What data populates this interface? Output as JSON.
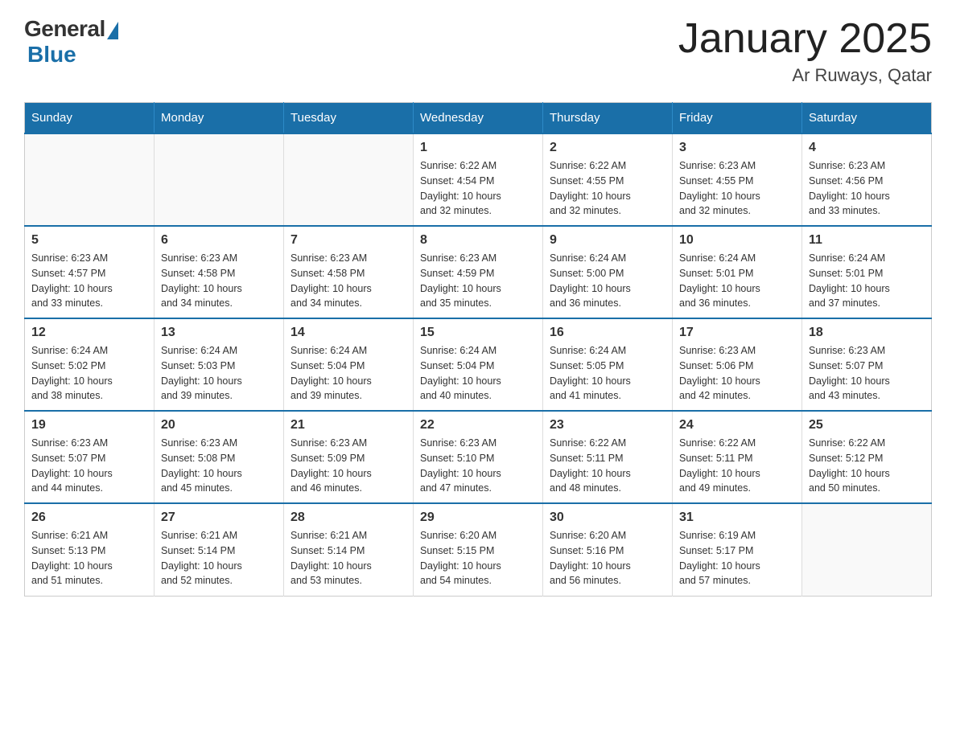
{
  "logo": {
    "general": "General",
    "blue": "Blue"
  },
  "title": "January 2025",
  "subtitle": "Ar Ruways, Qatar",
  "days_of_week": [
    "Sunday",
    "Monday",
    "Tuesday",
    "Wednesday",
    "Thursday",
    "Friday",
    "Saturday"
  ],
  "weeks": [
    [
      {
        "day": "",
        "info": ""
      },
      {
        "day": "",
        "info": ""
      },
      {
        "day": "",
        "info": ""
      },
      {
        "day": "1",
        "info": "Sunrise: 6:22 AM\nSunset: 4:54 PM\nDaylight: 10 hours\nand 32 minutes."
      },
      {
        "day": "2",
        "info": "Sunrise: 6:22 AM\nSunset: 4:55 PM\nDaylight: 10 hours\nand 32 minutes."
      },
      {
        "day": "3",
        "info": "Sunrise: 6:23 AM\nSunset: 4:55 PM\nDaylight: 10 hours\nand 32 minutes."
      },
      {
        "day": "4",
        "info": "Sunrise: 6:23 AM\nSunset: 4:56 PM\nDaylight: 10 hours\nand 33 minutes."
      }
    ],
    [
      {
        "day": "5",
        "info": "Sunrise: 6:23 AM\nSunset: 4:57 PM\nDaylight: 10 hours\nand 33 minutes."
      },
      {
        "day": "6",
        "info": "Sunrise: 6:23 AM\nSunset: 4:58 PM\nDaylight: 10 hours\nand 34 minutes."
      },
      {
        "day": "7",
        "info": "Sunrise: 6:23 AM\nSunset: 4:58 PM\nDaylight: 10 hours\nand 34 minutes."
      },
      {
        "day": "8",
        "info": "Sunrise: 6:23 AM\nSunset: 4:59 PM\nDaylight: 10 hours\nand 35 minutes."
      },
      {
        "day": "9",
        "info": "Sunrise: 6:24 AM\nSunset: 5:00 PM\nDaylight: 10 hours\nand 36 minutes."
      },
      {
        "day": "10",
        "info": "Sunrise: 6:24 AM\nSunset: 5:01 PM\nDaylight: 10 hours\nand 36 minutes."
      },
      {
        "day": "11",
        "info": "Sunrise: 6:24 AM\nSunset: 5:01 PM\nDaylight: 10 hours\nand 37 minutes."
      }
    ],
    [
      {
        "day": "12",
        "info": "Sunrise: 6:24 AM\nSunset: 5:02 PM\nDaylight: 10 hours\nand 38 minutes."
      },
      {
        "day": "13",
        "info": "Sunrise: 6:24 AM\nSunset: 5:03 PM\nDaylight: 10 hours\nand 39 minutes."
      },
      {
        "day": "14",
        "info": "Sunrise: 6:24 AM\nSunset: 5:04 PM\nDaylight: 10 hours\nand 39 minutes."
      },
      {
        "day": "15",
        "info": "Sunrise: 6:24 AM\nSunset: 5:04 PM\nDaylight: 10 hours\nand 40 minutes."
      },
      {
        "day": "16",
        "info": "Sunrise: 6:24 AM\nSunset: 5:05 PM\nDaylight: 10 hours\nand 41 minutes."
      },
      {
        "day": "17",
        "info": "Sunrise: 6:23 AM\nSunset: 5:06 PM\nDaylight: 10 hours\nand 42 minutes."
      },
      {
        "day": "18",
        "info": "Sunrise: 6:23 AM\nSunset: 5:07 PM\nDaylight: 10 hours\nand 43 minutes."
      }
    ],
    [
      {
        "day": "19",
        "info": "Sunrise: 6:23 AM\nSunset: 5:07 PM\nDaylight: 10 hours\nand 44 minutes."
      },
      {
        "day": "20",
        "info": "Sunrise: 6:23 AM\nSunset: 5:08 PM\nDaylight: 10 hours\nand 45 minutes."
      },
      {
        "day": "21",
        "info": "Sunrise: 6:23 AM\nSunset: 5:09 PM\nDaylight: 10 hours\nand 46 minutes."
      },
      {
        "day": "22",
        "info": "Sunrise: 6:23 AM\nSunset: 5:10 PM\nDaylight: 10 hours\nand 47 minutes."
      },
      {
        "day": "23",
        "info": "Sunrise: 6:22 AM\nSunset: 5:11 PM\nDaylight: 10 hours\nand 48 minutes."
      },
      {
        "day": "24",
        "info": "Sunrise: 6:22 AM\nSunset: 5:11 PM\nDaylight: 10 hours\nand 49 minutes."
      },
      {
        "day": "25",
        "info": "Sunrise: 6:22 AM\nSunset: 5:12 PM\nDaylight: 10 hours\nand 50 minutes."
      }
    ],
    [
      {
        "day": "26",
        "info": "Sunrise: 6:21 AM\nSunset: 5:13 PM\nDaylight: 10 hours\nand 51 minutes."
      },
      {
        "day": "27",
        "info": "Sunrise: 6:21 AM\nSunset: 5:14 PM\nDaylight: 10 hours\nand 52 minutes."
      },
      {
        "day": "28",
        "info": "Sunrise: 6:21 AM\nSunset: 5:14 PM\nDaylight: 10 hours\nand 53 minutes."
      },
      {
        "day": "29",
        "info": "Sunrise: 6:20 AM\nSunset: 5:15 PM\nDaylight: 10 hours\nand 54 minutes."
      },
      {
        "day": "30",
        "info": "Sunrise: 6:20 AM\nSunset: 5:16 PM\nDaylight: 10 hours\nand 56 minutes."
      },
      {
        "day": "31",
        "info": "Sunrise: 6:19 AM\nSunset: 5:17 PM\nDaylight: 10 hours\nand 57 minutes."
      },
      {
        "day": "",
        "info": ""
      }
    ]
  ]
}
